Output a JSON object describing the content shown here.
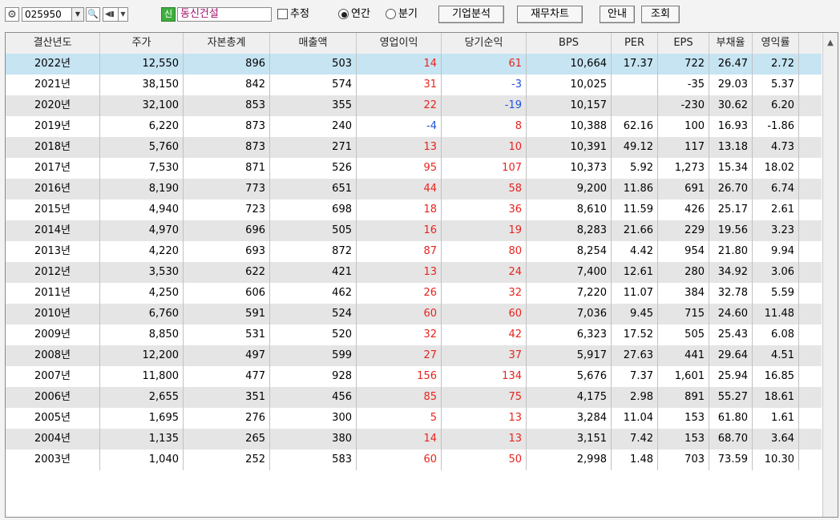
{
  "toolbar": {
    "code": "025950",
    "badge": "신",
    "company_name": "동신건설",
    "estimate_label": "추정",
    "radio_annual": "연간",
    "radio_quarter": "분기",
    "btn_company_analysis": "기업분석",
    "btn_financial_chart": "재무차트",
    "btn_guide": "안내",
    "btn_query": "조회",
    "icons": [
      "gear-icon",
      "search-icon",
      "volume-icon",
      "chevron-down-icon"
    ]
  },
  "table": {
    "columns": [
      "결산년도",
      "주가",
      "자본총계",
      "매출액",
      "영업이익",
      "당기순익",
      "BPS",
      "PER",
      "EPS",
      "부채율",
      "영익률"
    ],
    "rows": [
      [
        "2022년",
        "12,550",
        "896",
        "503",
        "14",
        "61",
        "10,664",
        "17.37",
        "722",
        "26.47",
        "2.72"
      ],
      [
        "2021년",
        "38,150",
        "842",
        "574",
        "31",
        "-3",
        "10,025",
        "",
        "-35",
        "29.03",
        "5.37"
      ],
      [
        "2020년",
        "32,100",
        "853",
        "355",
        "22",
        "-19",
        "10,157",
        "",
        "-230",
        "30.62",
        "6.20"
      ],
      [
        "2019년",
        "6,220",
        "873",
        "240",
        "-4",
        "8",
        "10,388",
        "62.16",
        "100",
        "16.93",
        "-1.86"
      ],
      [
        "2018년",
        "5,760",
        "873",
        "271",
        "13",
        "10",
        "10,391",
        "49.12",
        "117",
        "13.18",
        "4.73"
      ],
      [
        "2017년",
        "7,530",
        "871",
        "526",
        "95",
        "107",
        "10,373",
        "5.92",
        "1,273",
        "15.34",
        "18.02"
      ],
      [
        "2016년",
        "8,190",
        "773",
        "651",
        "44",
        "58",
        "9,200",
        "11.86",
        "691",
        "26.70",
        "6.74"
      ],
      [
        "2015년",
        "4,940",
        "723",
        "698",
        "18",
        "36",
        "8,610",
        "11.59",
        "426",
        "25.17",
        "2.61"
      ],
      [
        "2014년",
        "4,970",
        "696",
        "505",
        "16",
        "19",
        "8,283",
        "21.66",
        "229",
        "19.56",
        "3.23"
      ],
      [
        "2013년",
        "4,220",
        "693",
        "872",
        "87",
        "80",
        "8,254",
        "4.42",
        "954",
        "21.80",
        "9.94"
      ],
      [
        "2012년",
        "3,530",
        "622",
        "421",
        "13",
        "24",
        "7,400",
        "12.61",
        "280",
        "34.92",
        "3.06"
      ],
      [
        "2011년",
        "4,250",
        "606",
        "462",
        "26",
        "32",
        "7,220",
        "11.07",
        "384",
        "32.78",
        "5.59"
      ],
      [
        "2010년",
        "6,760",
        "591",
        "524",
        "60",
        "60",
        "7,036",
        "9.45",
        "715",
        "24.60",
        "11.48"
      ],
      [
        "2009년",
        "8,850",
        "531",
        "520",
        "32",
        "42",
        "6,323",
        "17.52",
        "505",
        "25.43",
        "6.08"
      ],
      [
        "2008년",
        "12,200",
        "497",
        "599",
        "27",
        "37",
        "5,917",
        "27.63",
        "441",
        "29.64",
        "4.51"
      ],
      [
        "2007년",
        "11,800",
        "477",
        "928",
        "156",
        "134",
        "5,676",
        "7.37",
        "1,601",
        "25.94",
        "16.85"
      ],
      [
        "2006년",
        "2,655",
        "351",
        "456",
        "85",
        "75",
        "4,175",
        "2.98",
        "891",
        "55.27",
        "18.61"
      ],
      [
        "2005년",
        "1,695",
        "276",
        "300",
        "5",
        "13",
        "3,284",
        "11.04",
        "153",
        "61.80",
        "1.61"
      ],
      [
        "2004년",
        "1,135",
        "265",
        "380",
        "14",
        "13",
        "3,151",
        "7.42",
        "153",
        "68.70",
        "3.64"
      ],
      [
        "2003년",
        "1,040",
        "252",
        "583",
        "60",
        "50",
        "2,998",
        "1.48",
        "703",
        "73.59",
        "10.30"
      ]
    ]
  },
  "colors": {
    "positive": "#e8231d",
    "negative": "#1f52e0",
    "selected_row": "#c6e4f2",
    "alt_row": "#e5e5e5"
  }
}
